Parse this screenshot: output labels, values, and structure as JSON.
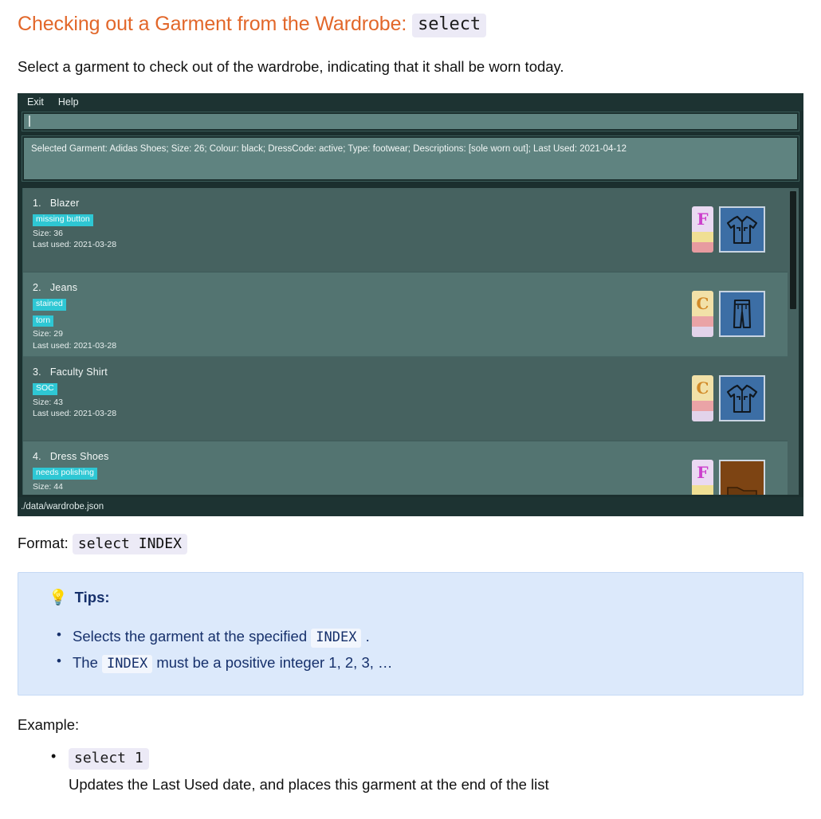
{
  "heading": {
    "text": "Checking out a Garment from the Wardrobe:",
    "command": "select"
  },
  "intro": "Select a garment to check out of the wardrobe, indicating that it shall be worn today.",
  "app": {
    "menu": [
      {
        "label": "Exit"
      },
      {
        "label": "Help"
      }
    ],
    "command_input": {
      "value": "",
      "placeholder": ""
    },
    "status_panel": "Selected Garment: Adidas Shoes; Size: 26; Colour: black; DressCode: active; Type: footwear; Descriptions: [sole worn out]; Last Used: 2021-04-12",
    "statusbar": "./data/wardrobe.json",
    "garments": [
      {
        "index": "1.",
        "name": "Blazer",
        "tags": [
          "missing button"
        ],
        "size": "Size: 36",
        "last_used": "Last used: 2021-03-28",
        "badge_letter": "F",
        "badge_letter_color": "#cc3fcc",
        "badge_main_bg": "#ead9f2",
        "badge_stripe1": "#f0df94",
        "badge_stripe2": "#e79ba0",
        "thumb_type": "shirt-icon"
      },
      {
        "index": "2.",
        "name": "Jeans",
        "tags": [
          "stained",
          "torn"
        ],
        "size": "Size: 29",
        "last_used": "Last used: 2021-03-28",
        "badge_letter": "C",
        "badge_letter_color": "#d18a28",
        "badge_main_bg": "#f2e1a8",
        "badge_stripe1": "#eaa3a6",
        "badge_stripe2": "#e2d3ea",
        "thumb_type": "trousers-icon"
      },
      {
        "index": "3.",
        "name": "Faculty Shirt",
        "tags": [
          "SOC"
        ],
        "size": "Size: 43",
        "last_used": "Last used: 2021-03-28",
        "badge_letter": "C",
        "badge_letter_color": "#d18a28",
        "badge_main_bg": "#f2e1a8",
        "badge_stripe1": "#eaa3a6",
        "badge_stripe2": "#e2d3ea",
        "thumb_type": "shirt-icon"
      },
      {
        "index": "4.",
        "name": "Dress Shoes",
        "tags": [
          "needs polishing"
        ],
        "size": "Size: 44",
        "last_used": "",
        "badge_letter": "F",
        "badge_letter_color": "#cc3fcc",
        "badge_main_bg": "#ead9f2",
        "badge_stripe1": "#f0df94",
        "badge_stripe2": "#e79ba0",
        "thumb_type": "shoe-icon"
      }
    ]
  },
  "format": {
    "label": "Format:",
    "code": "select INDEX"
  },
  "tips": {
    "bulb": "💡",
    "title": "Tips:",
    "items": [
      {
        "before": "Selects the garment at the specified",
        "code": "INDEX",
        "after": "."
      },
      {
        "before": "The",
        "code": "INDEX",
        "after": "must be a positive integer 1, 2, 3, …"
      }
    ]
  },
  "example": {
    "label": "Example:",
    "code": "select 1",
    "description": "Updates the Last Used date, and places this garment at the end of the list"
  }
}
